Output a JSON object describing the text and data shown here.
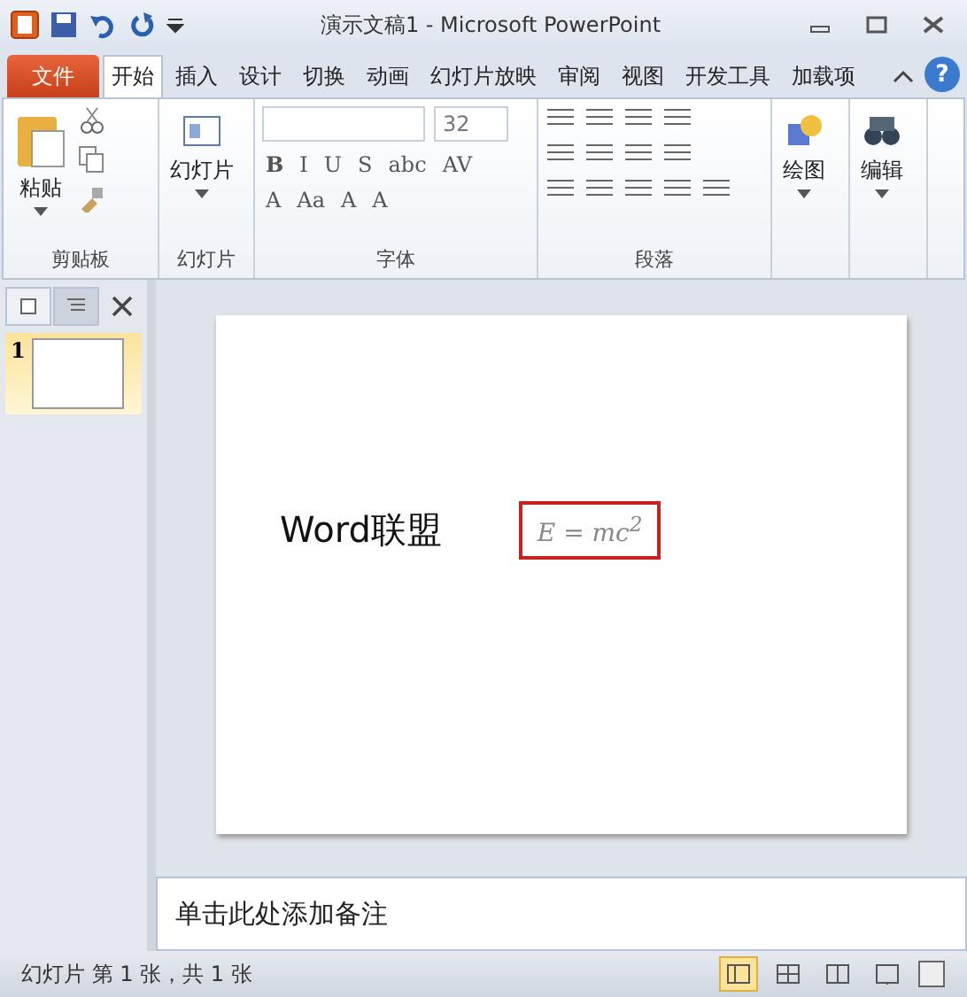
{
  "window": {
    "title": "演示文稿1 - Microsoft PowerPoint"
  },
  "file_tab": {
    "label": "文件"
  },
  "tabs": [
    {
      "label": "开始",
      "selected": true
    },
    {
      "label": "插入",
      "selected": false
    },
    {
      "label": "设计",
      "selected": false
    },
    {
      "label": "切换",
      "selected": false
    },
    {
      "label": "动画",
      "selected": false
    },
    {
      "label": "幻灯片放映",
      "selected": false
    },
    {
      "label": "审阅",
      "selected": false
    },
    {
      "label": "视图",
      "selected": false
    },
    {
      "label": "开发工具",
      "selected": false
    },
    {
      "label": "加载项",
      "selected": false
    }
  ],
  "help": {
    "label": "?"
  },
  "ribbon": {
    "clipboard": {
      "label": "剪贴板",
      "paste": "粘贴"
    },
    "slides": {
      "label": "幻灯片",
      "new_slide": "幻灯片"
    },
    "font": {
      "label": "字体",
      "size": "32",
      "row_1": [
        "B",
        "I",
        "U",
        "S",
        "abc",
        "AV"
      ],
      "row_2": [
        "A",
        "Aa",
        "A",
        "A"
      ]
    },
    "paragraph": {
      "label": "段落"
    },
    "drawing": {
      "label": "绘图"
    },
    "editing": {
      "label": "编辑"
    }
  },
  "panel_tabs": [
    {
      "kind": "slides",
      "selected": true
    },
    {
      "kind": "outline",
      "selected": false
    }
  ],
  "thumbnails": [
    {
      "number": "1",
      "selected": true
    }
  ],
  "slide": {
    "text": "Word联盟",
    "equation": "E = mc$^{2}$"
  },
  "notes": {
    "placeholder": "单击此处添加备注"
  },
  "status_bar": {
    "text": "幻灯片 第 1 张，共 1 张",
    "views": [
      {
        "kind": "normal",
        "selected": true
      },
      {
        "kind": "sorter",
        "selected": false
      },
      {
        "kind": "reading",
        "selected": false
      },
      {
        "kind": "show",
        "selected": false
      }
    ]
  }
}
